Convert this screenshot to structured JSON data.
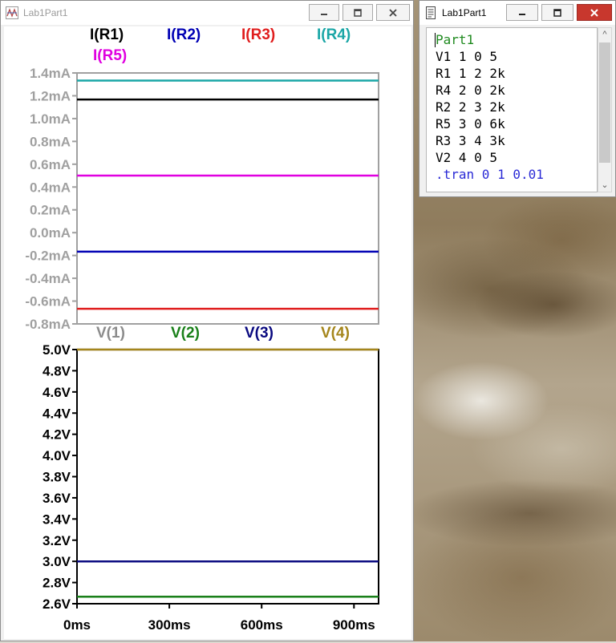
{
  "plot_window": {
    "title": "Lab1Part1",
    "controls": [
      "minimize",
      "maximize",
      "close"
    ]
  },
  "netlist_window": {
    "title": "Lab1Part1",
    "controls": [
      "minimize",
      "maximize",
      "close"
    ],
    "lines": [
      {
        "text": "Part1",
        "kind": "comment"
      },
      {
        "text": "V1 1 0 5",
        "kind": "element"
      },
      {
        "text": "R1 1 2 2k",
        "kind": "element"
      },
      {
        "text": "R4 2 0 2k",
        "kind": "element"
      },
      {
        "text": "R2 2 3 2k",
        "kind": "element"
      },
      {
        "text": "R5 3 0 6k",
        "kind": "element"
      },
      {
        "text": "R3 3 4 3k",
        "kind": "element"
      },
      {
        "text": "V2 4 0 5",
        "kind": "element"
      },
      {
        "text": ".tran 0 1 0.01",
        "kind": "directive"
      }
    ]
  },
  "chart_data": [
    {
      "type": "line",
      "x": [
        0,
        0.98
      ],
      "xlim": [
        0,
        0.98
      ],
      "ylim": [
        -0.8,
        1.4
      ],
      "yticks": [
        {
          "value": 1.4,
          "label": "1.4mA"
        },
        {
          "value": 1.2,
          "label": "1.2mA"
        },
        {
          "value": 1.0,
          "label": "1.0mA"
        },
        {
          "value": 0.8,
          "label": "0.8mA"
        },
        {
          "value": 0.6,
          "label": "0.6mA"
        },
        {
          "value": 0.4,
          "label": "0.4mA"
        },
        {
          "value": 0.2,
          "label": "0.2mA"
        },
        {
          "value": 0.0,
          "label": "0.0mA"
        },
        {
          "value": -0.2,
          "label": "-0.2mA"
        },
        {
          "value": -0.4,
          "label": "-0.4mA"
        },
        {
          "value": -0.6,
          "label": "-0.6mA"
        },
        {
          "value": -0.8,
          "label": "-0.8mA"
        }
      ],
      "tick_label_color": "#a0a0a0",
      "series": [
        {
          "name": "I(R1)",
          "color": "#000000",
          "values": [
            1.167,
            1.167
          ]
        },
        {
          "name": "I(R2)",
          "color": "#0000b4",
          "values": [
            -0.167,
            -0.167
          ]
        },
        {
          "name": "I(R3)",
          "color": "#e01e1e",
          "values": [
            -0.667,
            -0.667
          ]
        },
        {
          "name": "I(R4)",
          "color": "#1aa6a6",
          "values": [
            1.333,
            1.333
          ]
        },
        {
          "name": "I(R5)",
          "color": "#e000e0",
          "values": [
            0.5,
            0.5
          ]
        }
      ]
    },
    {
      "type": "line",
      "x": [
        0,
        0.98
      ],
      "xlim": [
        0,
        0.98
      ],
      "ylim": [
        2.6,
        5.0
      ],
      "yticks": [
        {
          "value": 5.0,
          "label": "5.0V"
        },
        {
          "value": 4.8,
          "label": "4.8V"
        },
        {
          "value": 4.6,
          "label": "4.6V"
        },
        {
          "value": 4.4,
          "label": "4.4V"
        },
        {
          "value": 4.2,
          "label": "4.2V"
        },
        {
          "value": 4.0,
          "label": "4.0V"
        },
        {
          "value": 3.8,
          "label": "3.8V"
        },
        {
          "value": 3.6,
          "label": "3.6V"
        },
        {
          "value": 3.4,
          "label": "3.4V"
        },
        {
          "value": 3.2,
          "label": "3.2V"
        },
        {
          "value": 3.0,
          "label": "3.0V"
        },
        {
          "value": 2.8,
          "label": "2.8V"
        },
        {
          "value": 2.6,
          "label": "2.6V"
        }
      ],
      "xticks": [
        {
          "value": 0,
          "label": "0ms"
        },
        {
          "value": 0.3,
          "label": "300ms"
        },
        {
          "value": 0.6,
          "label": "600ms"
        },
        {
          "value": 0.9,
          "label": "900ms"
        }
      ],
      "tick_label_color": "#000000",
      "series": [
        {
          "name": "V(1)",
          "color": "#8c8c8c",
          "values": [
            5.0,
            5.0
          ]
        },
        {
          "name": "V(2)",
          "color": "#1a801a",
          "values": [
            2.667,
            2.667
          ]
        },
        {
          "name": "V(3)",
          "color": "#0a0a80",
          "values": [
            3.0,
            3.0
          ]
        },
        {
          "name": "V(4)",
          "color": "#a5861c",
          "values": [
            5.0,
            5.0
          ]
        }
      ]
    }
  ]
}
